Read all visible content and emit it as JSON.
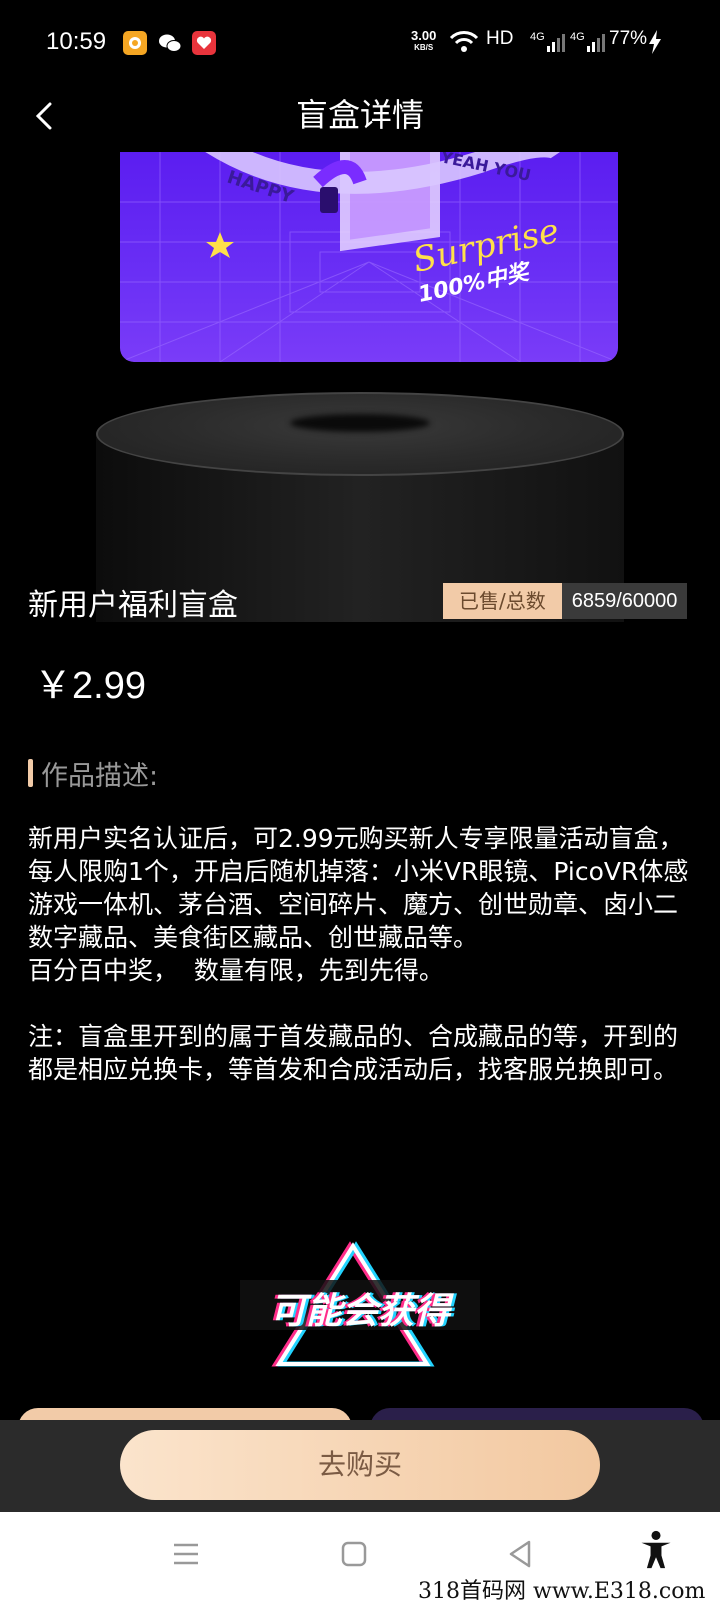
{
  "status_bar": {
    "time": "10:59",
    "net_speed_value": "3.00",
    "net_speed_unit": "KB/S",
    "hd_label": "HD",
    "signal1_label": "4G",
    "signal2_label": "4G",
    "battery": "77%"
  },
  "nav": {
    "title": "盲盒详情"
  },
  "hero": {
    "card_text_top_left": "HAPPY",
    "card_text_top_right": "YEAH YOU",
    "card_script": "Surprise",
    "card_caption": "100%中奖"
  },
  "product": {
    "name": "新用户福利盲盒",
    "sold_label": "已售/总数",
    "sold_value": "6859/60000",
    "price": "￥2.99"
  },
  "description": {
    "title": "作品描述:",
    "body": "新用户实名认证后，可2.99元购买新人专享限量活动盲盒，每人限购1个，开启后随机掉落：小米VR眼镜、PicoVR体感游戏一体机、茅台酒、空间碎片、魔方、创世勋章、卤小二数字藏品、美食街区藏品、创世藏品等。\n百分百中奖，  数量有限，先到先得。\n\n注：盲盒里开到的属于首发藏品的、合成藏品的等，开到的都是相应兑换卡，等首发和合成活动后，找客服兑换即可。"
  },
  "rewards": {
    "banner_text": "可能会获得"
  },
  "buy": {
    "button_label": "去购买"
  },
  "watermark": "318首码网  www.E318.com",
  "colors": {
    "accent_gold": "#f2cba8",
    "card_purple": "#5a1cf0"
  }
}
